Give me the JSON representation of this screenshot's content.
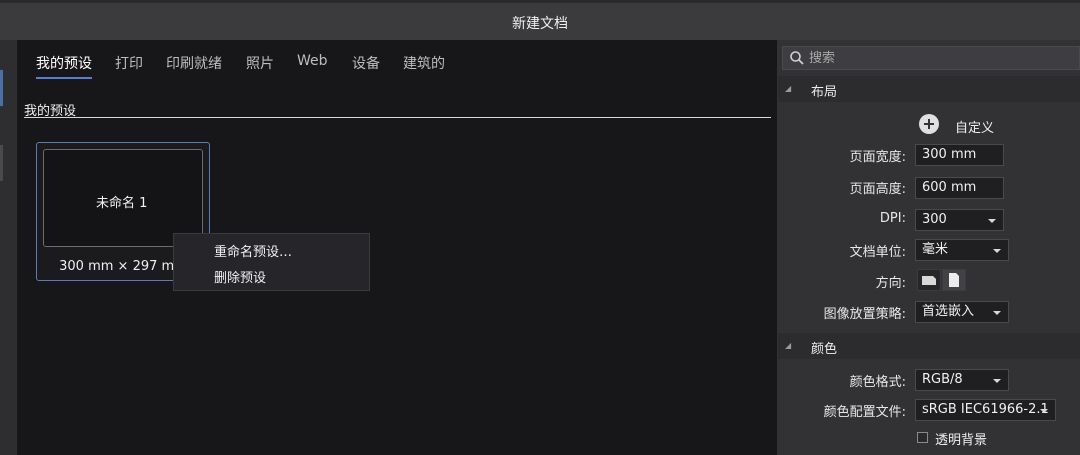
{
  "window": {
    "title": "新建文档"
  },
  "tabs": [
    {
      "label": "我的预设",
      "active": true
    },
    {
      "label": "打印"
    },
    {
      "label": "印刷就绪"
    },
    {
      "label": "照片"
    },
    {
      "label": "Web"
    },
    {
      "label": "设备"
    },
    {
      "label": "建筑的"
    }
  ],
  "section": {
    "title": "我的预设"
  },
  "preset": {
    "name": "未命名 1",
    "size": "300 mm × 297 mm"
  },
  "context_menu": {
    "items": [
      "重命名预设…",
      "删除预设"
    ]
  },
  "panel": {
    "search": {
      "placeholder": "搜索",
      "icon": "search-icon"
    },
    "layout": {
      "title": "布局",
      "custom_label": "自定义",
      "page_width_label": "页面宽度:",
      "page_width": "300 mm",
      "page_height_label": "页面高度:",
      "page_height": "600 mm",
      "dpi_label": "DPI:",
      "dpi": "300",
      "units_label": "文档单位:",
      "units": "毫米",
      "orientation_label": "方向:",
      "placement_label": "图像放置策略:",
      "placement": "首选嵌入"
    },
    "color": {
      "title": "颜色",
      "format_label": "颜色格式:",
      "format": "RGB/8",
      "profile_label": "颜色配置文件:",
      "profile": "sRGB IEC61966-2.1",
      "transparent_label": "透明背景",
      "transparent_checked": false
    }
  },
  "colors": {
    "accent": "#4f7fd6",
    "panel_bg": "#323235",
    "main_bg": "#171719"
  }
}
